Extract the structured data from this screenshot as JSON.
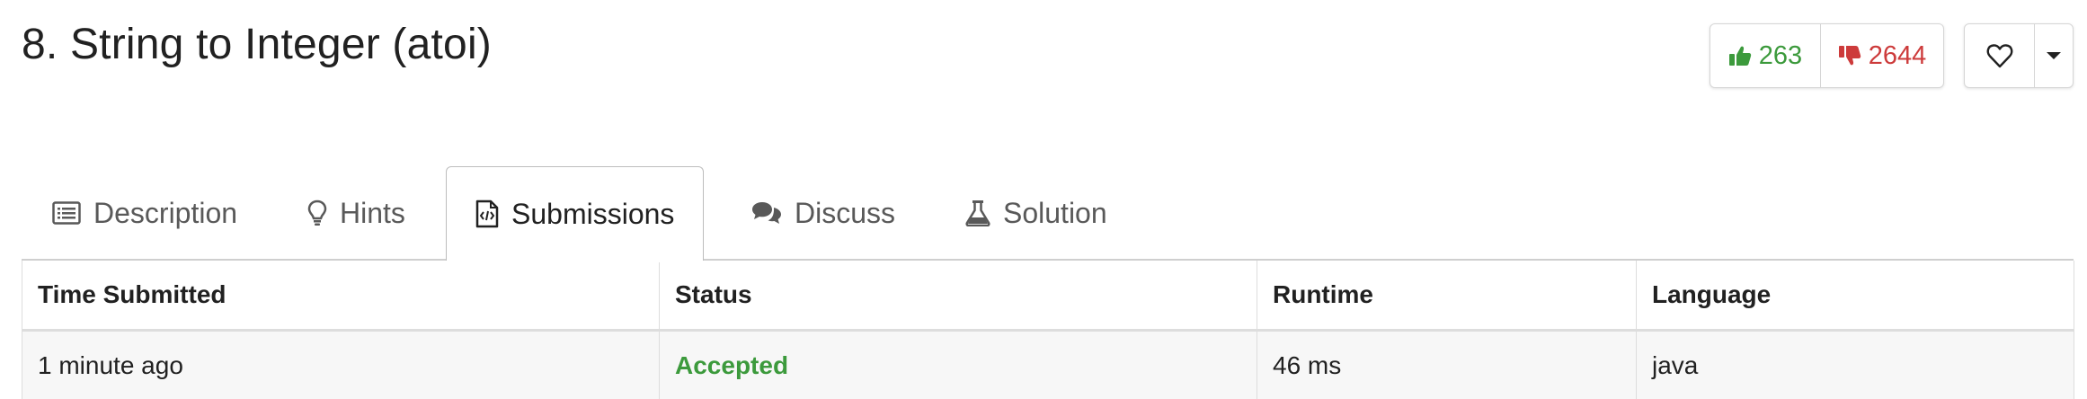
{
  "problem": {
    "title": "8. String to Integer (atoi)"
  },
  "votes": {
    "likes": "263",
    "dislikes": "2644"
  },
  "icons": {
    "like": "thumbs-up-icon",
    "dislike": "thumbs-down-icon",
    "favorite": "heart-icon",
    "more": "caret-down-icon",
    "description": "list-icon",
    "hints": "lightbulb-icon",
    "submissions": "code-file-icon",
    "discuss": "comments-icon",
    "solution": "flask-icon"
  },
  "colors": {
    "like": "#3c9a3c",
    "dislike": "#cd3b3b",
    "accepted": "#3c9a3c"
  },
  "tabs": [
    {
      "label": "Description"
    },
    {
      "label": "Hints"
    },
    {
      "label": "Submissions",
      "active": true
    },
    {
      "label": "Discuss"
    },
    {
      "label": "Solution"
    }
  ],
  "table": {
    "columns": [
      "Time Submitted",
      "Status",
      "Runtime",
      "Language"
    ],
    "rows": [
      {
        "time": "1 minute ago",
        "status": "Accepted",
        "runtime": "46 ms",
        "language": "java"
      }
    ]
  }
}
